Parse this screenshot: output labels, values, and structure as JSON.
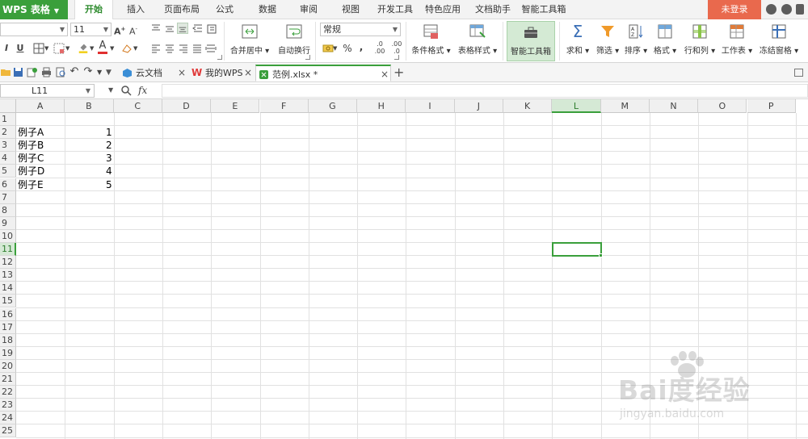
{
  "app": {
    "name": "WPS 表格",
    "login": "未登录"
  },
  "menu": [
    "开始",
    "插入",
    "页面布局",
    "公式",
    "数据",
    "审阅",
    "视图",
    "开发工具",
    "特色应用",
    "文档助手",
    "智能工具箱"
  ],
  "ribbon": {
    "font_size": "11",
    "number_format": "常规",
    "merge_center": "合并居中",
    "wrap_text": "自动换行",
    "percent": "%",
    "thousands": "000",
    "cond_format": "条件格式",
    "table_style": "表格样式",
    "smart_toolbox": "智能工具箱",
    "sum": "求和",
    "filter": "筛选",
    "sort": "排序",
    "format": "格式",
    "row_col": "行和列",
    "worksheet": "工作表",
    "freeze": "冻结窗格"
  },
  "tabs": [
    {
      "label": "云文档"
    },
    {
      "label": "我的WPS"
    },
    {
      "label": "范例.xlsx *"
    }
  ],
  "formula_bar": {
    "cell_ref": "L11",
    "fx": "fx",
    "content": ""
  },
  "sheet": {
    "columns": [
      "A",
      "B",
      "C",
      "D",
      "E",
      "F",
      "G",
      "H",
      "I",
      "J",
      "K",
      "L",
      "M",
      "N",
      "O",
      "P"
    ],
    "rows": [
      "1",
      "2",
      "3",
      "4",
      "5",
      "6",
      "7",
      "8",
      "9",
      "10",
      "11",
      "12",
      "13",
      "14",
      "15",
      "16",
      "17",
      "18",
      "19",
      "20",
      "21",
      "22",
      "23",
      "24",
      "25"
    ],
    "selected_cell": "L11",
    "data": [
      {
        "row": 2,
        "a": "例子A",
        "b": "1"
      },
      {
        "row": 3,
        "a": "例子B",
        "b": "2"
      },
      {
        "row": 4,
        "a": "例子C",
        "b": "3"
      },
      {
        "row": 5,
        "a": "例子D",
        "b": "4"
      },
      {
        "row": 6,
        "a": "例子E",
        "b": "5"
      }
    ]
  },
  "watermark": {
    "brand": "Bai度经验",
    "url": "jingyan.baidu.com"
  },
  "colors": {
    "accent": "#3a9f3b",
    "login": "#e9694d"
  }
}
